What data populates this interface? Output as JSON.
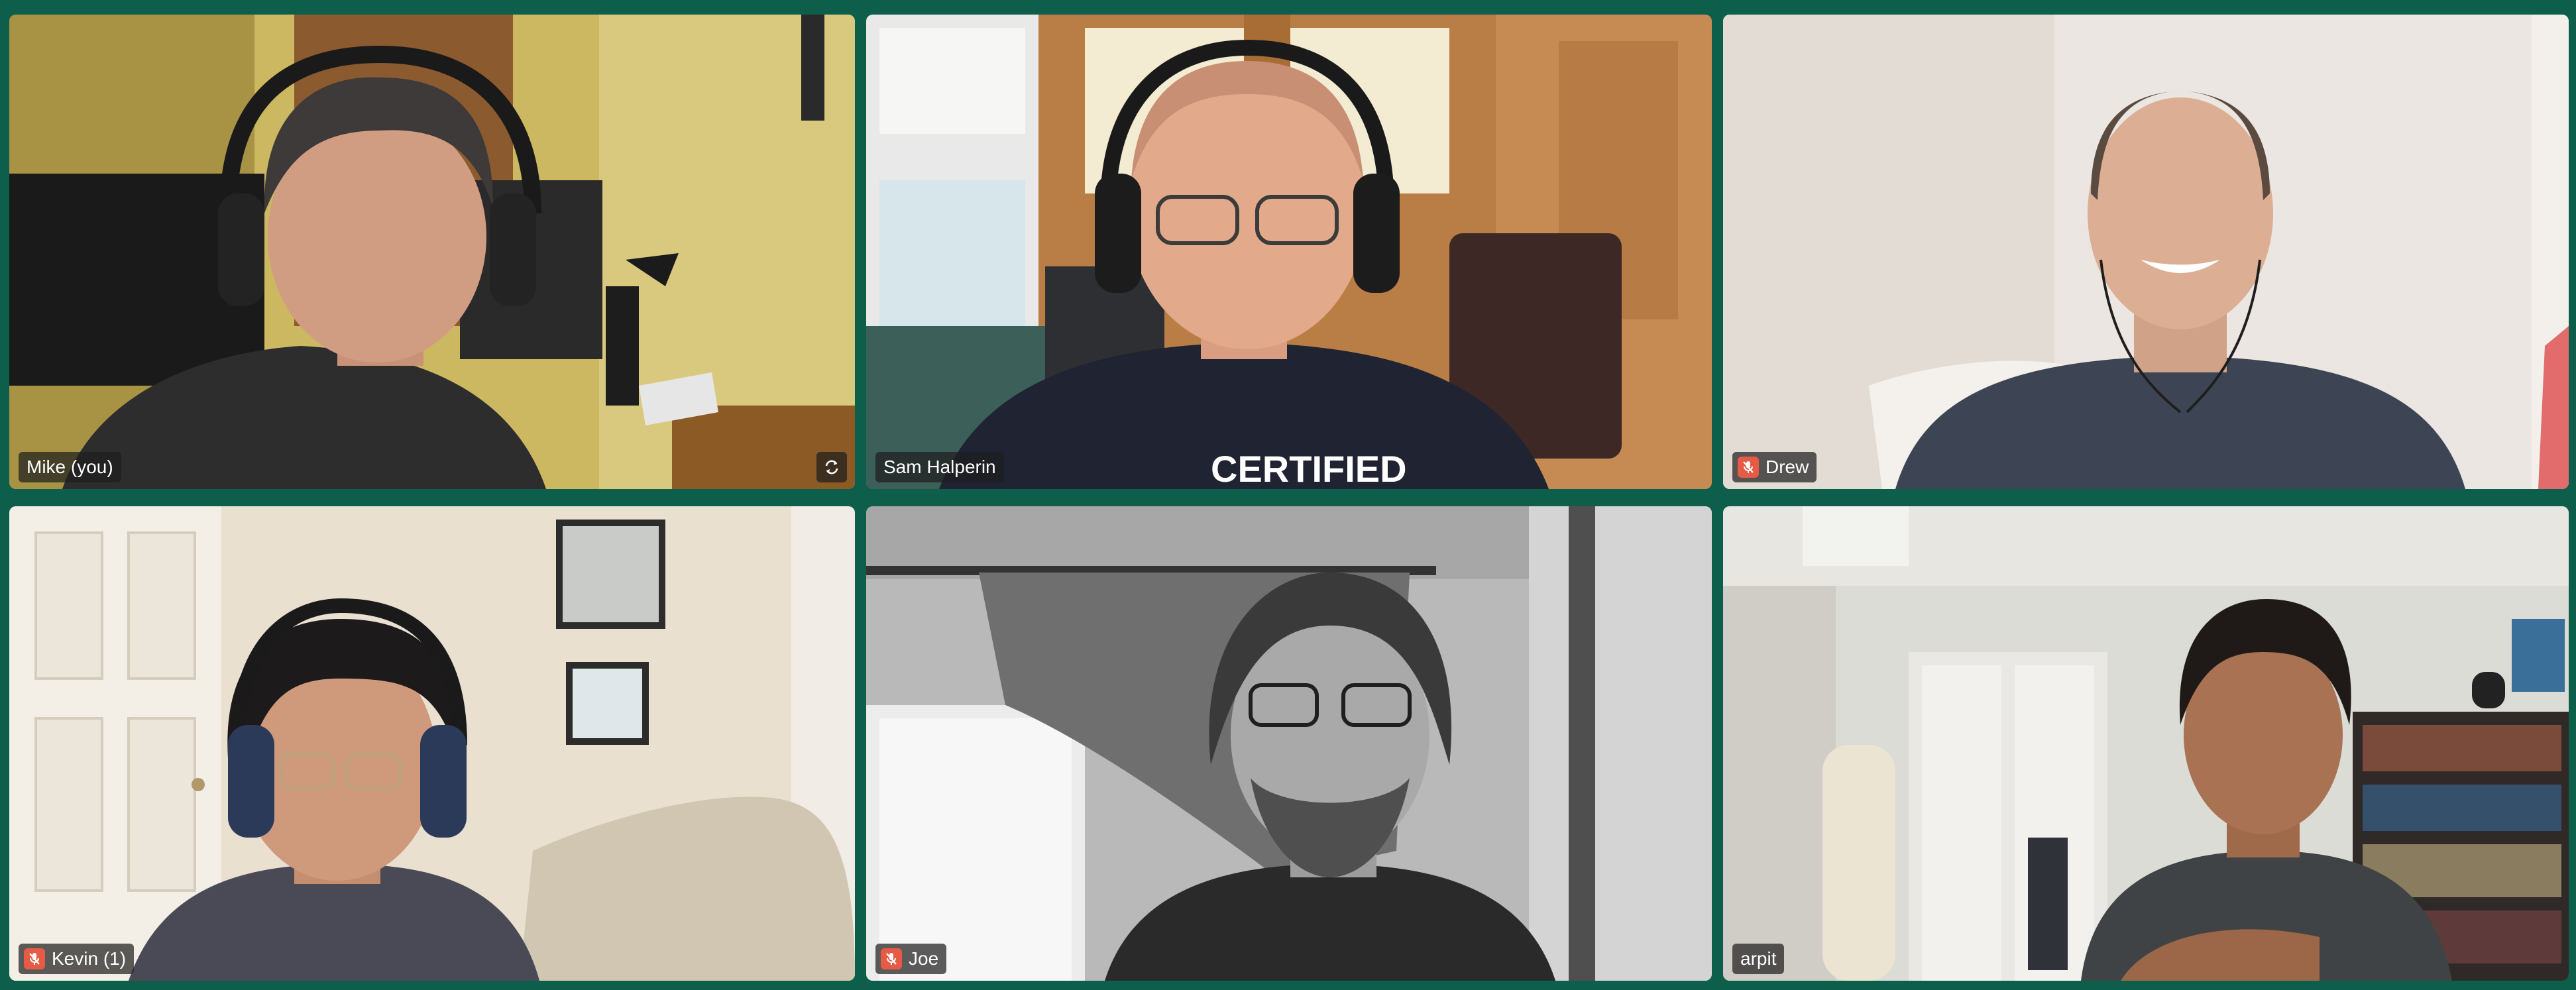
{
  "call": {
    "background_color": "#0e5e4c",
    "participants": [
      {
        "name": "Mike (you)",
        "muted": false,
        "self_view": true
      },
      {
        "name": "Sam Halperin",
        "muted": false
      },
      {
        "name": "Drew",
        "muted": true
      },
      {
        "name": "Kevin (1)",
        "muted": true
      },
      {
        "name": "Joe",
        "muted": true
      },
      {
        "name": "arpit",
        "muted": false
      }
    ],
    "shirt_text": "CERTIFIED",
    "mute_color": "#e65b45",
    "icons": {
      "mute": "microphone-muted-icon",
      "sync": "camera-switch-icon"
    }
  }
}
